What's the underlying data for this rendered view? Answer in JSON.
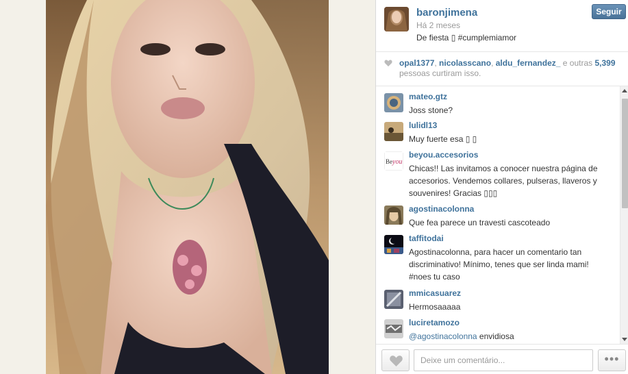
{
  "post": {
    "username": "baronjimena",
    "time": "Há 2 meses",
    "caption": "De fiesta ▯ #cumplemiamor",
    "follow_label": "Seguir"
  },
  "likes": {
    "users": [
      "opal1377",
      "nicolasscano",
      "aldu_fernandez_"
    ],
    "and_others": "e outras",
    "count": "5,399",
    "suffix": "pessoas curtiram isso."
  },
  "comments": [
    {
      "user": "mateo.gtz",
      "text": "Joss stone?"
    },
    {
      "user": "lulidl13",
      "text": "Muy fuerte esa ▯ ▯"
    },
    {
      "user": "beyou.accesorios",
      "text": "Chicas!! Las invitamos a conocer nuestra página de accesorios. Vendemos collares, pulseras, llaveros y souvenires! Gracias ▯▯▯"
    },
    {
      "user": "agostinacolonna",
      "text": "Que fea parece un travesti cascoteado"
    },
    {
      "user": "taffitodai",
      "text": "Agostinacolonna, para hacer un comentario tan discriminativo! Mínimo, tenes que ser linda mami! #noes tu caso"
    },
    {
      "user": "mmicasuarez",
      "text": "Hermosaaaaa"
    },
    {
      "user": "luciretamozo",
      "mention": "@agostinacolonna",
      "text": " envidiosa"
    }
  ],
  "footer": {
    "placeholder": "Deixe um comentário...",
    "more_label": "•••"
  },
  "colors": {
    "link": "#3f729b",
    "follow_button": "#5a82a6"
  },
  "icons": {
    "like": "heart-icon",
    "more": "ellipsis-icon"
  }
}
